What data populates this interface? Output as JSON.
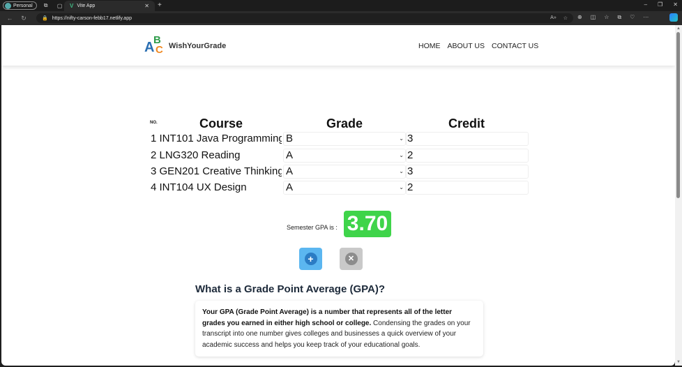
{
  "browser": {
    "profile_label": "Personal",
    "tab_title": "Vite App",
    "url": "https://nifty-carson-febb17.netlify.app"
  },
  "site": {
    "logo_letters": [
      "A",
      "B",
      "C"
    ],
    "brand": "WishYourGrade",
    "nav": [
      "HOME",
      "ABOUT US",
      "CONTACT US"
    ]
  },
  "table": {
    "no_header": "NO.",
    "course_header": "Course",
    "grade_header": "Grade",
    "credit_header": "Credit",
    "rows": [
      {
        "course": "1 INT101 Java Programming",
        "grade": "B",
        "credit": "3"
      },
      {
        "course": "2 LNG320 Reading",
        "grade": "A",
        "credit": "2"
      },
      {
        "course": "3 GEN201 Creative Thinking",
        "grade": "A",
        "credit": "3"
      },
      {
        "course": "4 INT104 UX Design",
        "grade": "A",
        "credit": "2"
      }
    ]
  },
  "gpa": {
    "label": "Semester GPA is :",
    "value": "3.70",
    "badge_color": "#3fd44a"
  },
  "buttons": {
    "add_icon": "plus-icon",
    "clear_icon": "close-icon"
  },
  "faq": {
    "title": "What is a Grade Point Average (GPA)?",
    "bold_text": "Your GPA (Grade Point Average) is a number that represents all of the letter grades you earned in either high school or college.",
    "body_text": " Condensing the grades on your transcript into one number gives colleges and businesses a quick overview of your academic success and helps you keep track of your educational goals."
  }
}
